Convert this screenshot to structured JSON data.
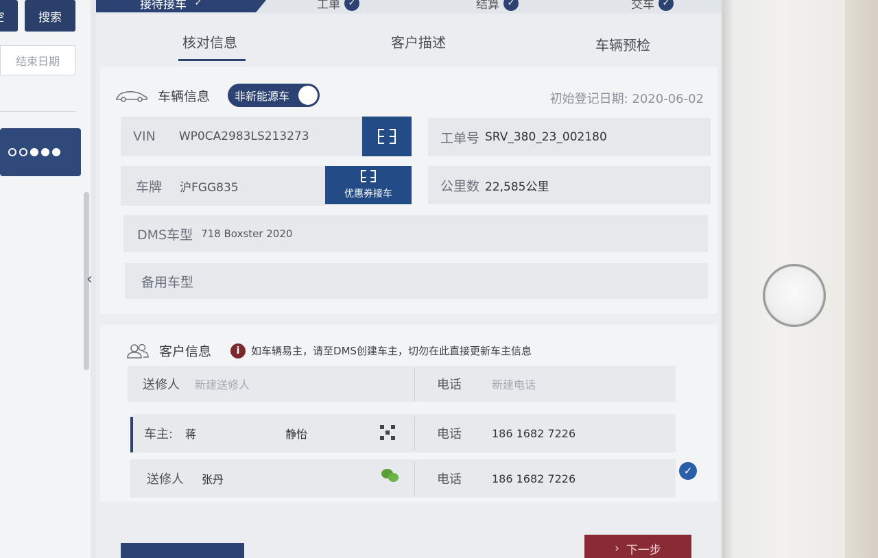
{
  "sidebar": {
    "clear_label": "空",
    "search_label": "搜索",
    "end_date_placeholder": "结束日期",
    "collapse_arrow": "‹"
  },
  "steps": [
    {
      "label": "接待接车",
      "done": true
    },
    {
      "label": "工单",
      "done": true
    },
    {
      "label": "结算",
      "done": true
    },
    {
      "label": "交车",
      "done": true
    }
  ],
  "tabs": [
    {
      "label": "核对信息",
      "active": true
    },
    {
      "label": "客户描述",
      "active": false
    },
    {
      "label": "车辆预检",
      "active": false
    }
  ],
  "vehicle": {
    "section_title": "车辆信息",
    "energy_toggle_label": "非新能源车",
    "first_reg_label": "初始登记日期:",
    "first_reg_value": "2020-06-02",
    "vin_label": "VIN",
    "vin_value": "WP0CA2983LS213273",
    "order_label": "工单号",
    "order_value": "SRV_380_23_002180",
    "plate_label": "车牌",
    "plate_value": "沪FGG835",
    "coupon_button": "优惠券接车",
    "mileage_label": "公里数",
    "mileage_value": "22,585公里",
    "dms_label": "DMS车型",
    "dms_value": "718 Boxster 2020",
    "backup_label": "备用车型"
  },
  "customer": {
    "section_title": "客户信息",
    "notice": "如车辆易主，请至DMS创建车主，切勿在此直接更新车主信息",
    "rows": [
      {
        "role": "送修人",
        "name": "新建送修人",
        "name_is_placeholder": true,
        "phone_label": "电话",
        "phone": "新建电话",
        "phone_is_placeholder": true
      },
      {
        "role": "车主:",
        "name": "蒋",
        "name2": "静怡",
        "phone_label": "电话",
        "phone": "186 1682 7226"
      },
      {
        "role": "送修人",
        "name": "张丹",
        "phone_label": "电话",
        "phone": "186 1682 7226",
        "selected": true
      }
    ]
  },
  "footer": {
    "next_label": "下一步"
  },
  "colors": {
    "brand_blue": "#2b4272",
    "next_red": "#8a2a35",
    "warning_red": "#7a2a2e"
  }
}
